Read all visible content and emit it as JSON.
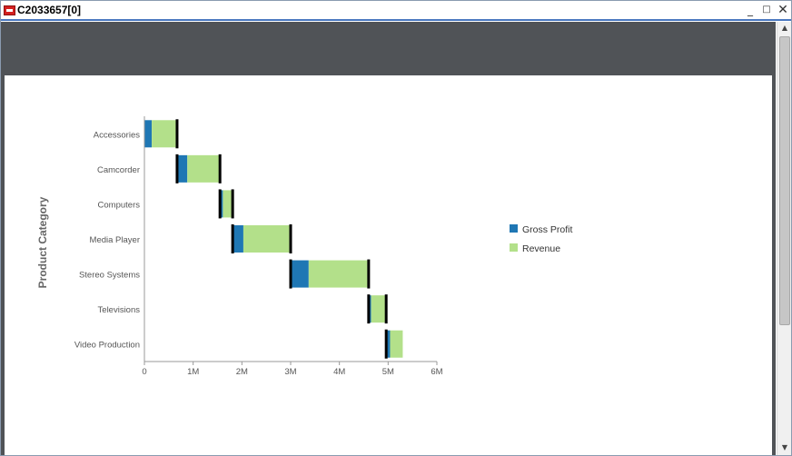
{
  "window": {
    "title": "C2033657[0]",
    "controls": {
      "minimize": "_",
      "maximize": "□",
      "close": "✕"
    }
  },
  "scrollbar": {
    "up": "▲",
    "down": "▼"
  },
  "colors": {
    "gross_profit": "#1f77b4",
    "revenue": "#b3e08a",
    "connector": "#000000",
    "axis": "#999999",
    "label": "#555555"
  },
  "chart_data": {
    "type": "bar",
    "orientation": "horizontal",
    "style": "waterfall",
    "ylabel": "Product Category",
    "xlabel": "",
    "categories": [
      "Accessories",
      "Camcorder",
      "Computers",
      "Media Player",
      "Stereo Systems",
      "Televisions",
      "Video Production"
    ],
    "start": [
      0,
      0.67,
      1.55,
      1.81,
      3.0,
      4.6,
      4.96
    ],
    "series": [
      {
        "name": "Gross Profit",
        "color": "#1f77b4",
        "values": [
          0.15,
          0.21,
          0.06,
          0.22,
          0.37,
          0.05,
          0.08
        ]
      },
      {
        "name": "Revenue",
        "color": "#b3e08a",
        "values": [
          0.52,
          0.67,
          0.2,
          0.97,
          1.23,
          0.31,
          0.26
        ]
      }
    ],
    "xlim": [
      0,
      6
    ],
    "xticks": [
      0,
      1,
      2,
      3,
      4,
      5,
      6
    ],
    "xtick_labels": [
      "0",
      "1M",
      "2M",
      "3M",
      "4M",
      "5M",
      "6M"
    ],
    "legend_position": "right",
    "grid": false
  }
}
